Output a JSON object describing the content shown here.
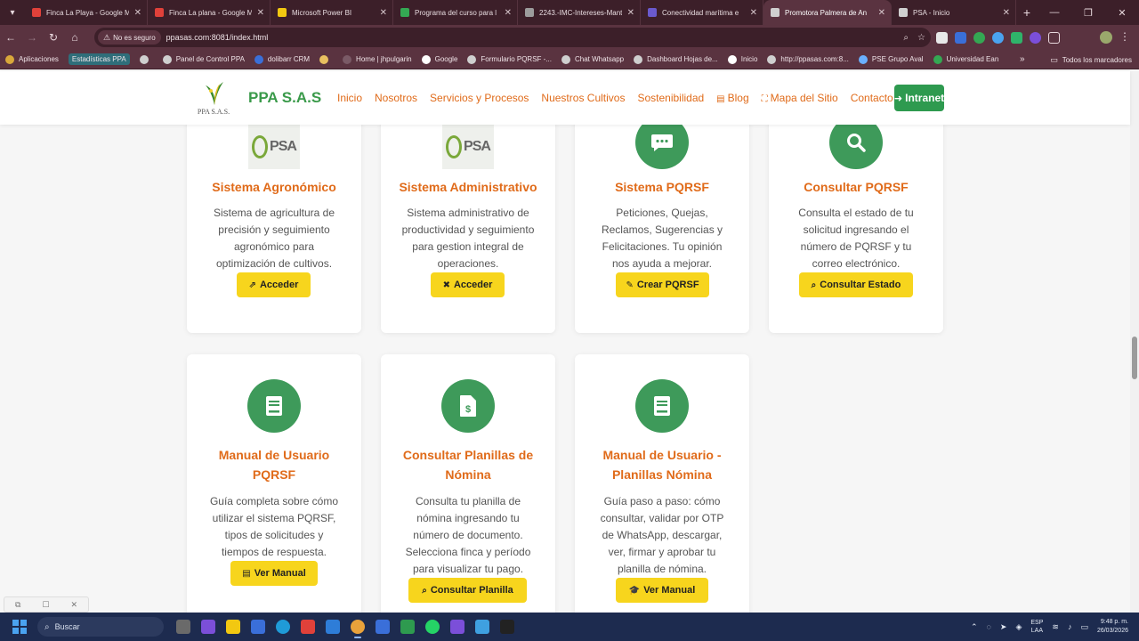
{
  "browser": {
    "tabs": [
      {
        "label": "Finca La Playa - Google M",
        "color": "#e0413a",
        "active": false
      },
      {
        "label": "Finca La plana - Google M",
        "color": "#e0413a",
        "active": false
      },
      {
        "label": "Microsoft Power BI",
        "color": "#f2c811",
        "active": false
      },
      {
        "label": "Programa del curso para l",
        "color": "#34a853",
        "active": false
      },
      {
        "label": "2243.-IMC-Intereses-Mant",
        "color": "#9c9c9c",
        "active": false
      },
      {
        "label": "Conectividad marítima e",
        "color": "#6a5acd",
        "active": false
      },
      {
        "label": "Promotora Palmera de An",
        "color": "#cfcfcf",
        "active": true
      },
      {
        "label": "PSA - Inicio",
        "color": "#cfcfcf",
        "active": false
      }
    ],
    "security_label": "No es seguro",
    "url": "ppasas.com:8081/index.html",
    "bookmarks": [
      {
        "label": "Aplicaciones",
        "color": "#d9a83a"
      },
      {
        "label": "Estadísticas PPA",
        "color": "",
        "highlight": true
      },
      {
        "label": "",
        "color": "#cfcfcf"
      },
      {
        "label": "Panel de Control PPA",
        "color": "#cfcfcf"
      },
      {
        "label": "dolibarr CRM",
        "color": "#3a6fd9"
      },
      {
        "label": "",
        "color": "#e8c060"
      },
      {
        "label": "Home | jhpulgarin",
        "color": "#7a5a66"
      },
      {
        "label": "Google",
        "color": "#ffffff"
      },
      {
        "label": "Formulario PQRSF -...",
        "color": "#cfcfcf"
      },
      {
        "label": "Chat Whatsapp",
        "color": "#cfcfcf"
      },
      {
        "label": "Dashboard Hojas de...",
        "color": "#cfcfcf"
      },
      {
        "label": "Inicio",
        "color": "#ffffff"
      },
      {
        "label": "http://ppasas.com:8...",
        "color": "#cfcfcf"
      },
      {
        "label": "PSE Grupo Aval",
        "color": "#6ab0ff"
      },
      {
        "label": "Universidad Ean",
        "color": "#34a853"
      }
    ],
    "bookmarks_all": "Todos los marcadores"
  },
  "header": {
    "logo_text": "PPA S.A.S.",
    "brand": "PPA S.A.S",
    "menu": [
      {
        "label": "Inicio",
        "icon": ""
      },
      {
        "label": "Nosotros",
        "icon": ""
      },
      {
        "label": "Servicios y Procesos",
        "icon": ""
      },
      {
        "label": "Nuestros Cultivos",
        "icon": ""
      },
      {
        "label": "Sostenibilidad",
        "icon": ""
      },
      {
        "label": "Blog",
        "icon": "book-icon"
      },
      {
        "label": "Mapa del Sitio",
        "icon": "sitemap-icon"
      },
      {
        "label": "Contacto",
        "icon": ""
      }
    ],
    "intranet_label": "Intranet"
  },
  "cards": [
    {
      "title": "Sistema Agronómico",
      "desc": "Sistema de agricultura de precisión y seguimiento agronómico para optimización de cultivos.",
      "button": "Acceder",
      "icon": "psa-logo",
      "btn_icon": "external-link-icon"
    },
    {
      "title": "Sistema Administrativo",
      "desc": "Sistema administrativo de productividad y seguimiento para gestion integral de operaciones.",
      "button": "Acceder",
      "icon": "psa-logo",
      "btn_icon": "tools-icon"
    },
    {
      "title": "Sistema PQRSF",
      "desc": "Peticiones, Quejas, Reclamos, Sugerencias y Felicitaciones. Tu opinión nos ayuda a mejorar.",
      "button": "Crear PQRSF",
      "icon": "chat-icon",
      "btn_icon": "edit-icon"
    },
    {
      "title": "Consultar PQRSF",
      "desc": "Consulta el estado de tu solicitud ingresando el número de PQRSF y tu correo electrónico.",
      "button": "Consultar Estado",
      "icon": "search-icon",
      "btn_icon": "search-icon"
    },
    {
      "title": "Manual de Usuario PQRSF",
      "desc": "Guía completa sobre cómo utilizar el sistema PQRSF, tipos de solicitudes y tiempos de respuesta.",
      "button": "Ver Manual",
      "icon": "book-icon",
      "btn_icon": "pdf-icon"
    },
    {
      "title": "Consultar Planillas de Nómina",
      "desc": "Consulta tu planilla de nómina ingresando tu número de documento. Selecciona finca y período para visualizar tu pago.",
      "button": "Consultar Planilla",
      "icon": "invoice-dollar-icon",
      "btn_icon": "search-icon"
    },
    {
      "title": "Manual de Usuario - Planillas Nómina",
      "desc": "Guía paso a paso: cómo consultar, validar por OTP de WhatsApp, descargar, ver, firmar y aprobar tu planilla de nómina.",
      "button": "Ver Manual",
      "icon": "book-icon",
      "btn_icon": "graduation-cap-icon"
    }
  ],
  "taskbar": {
    "search_label": "Buscar",
    "lang": "ESP",
    "lang_sub": "LAA",
    "time": "9:48 p. m.",
    "date": "26/03/2026"
  },
  "colors": {
    "accent_orange": "#e06b1a",
    "brand_green": "#3a9a4a",
    "icon_green": "#3e9a5a",
    "button_yellow": "#f7d51d",
    "intranet_green": "#2e9a4f"
  }
}
